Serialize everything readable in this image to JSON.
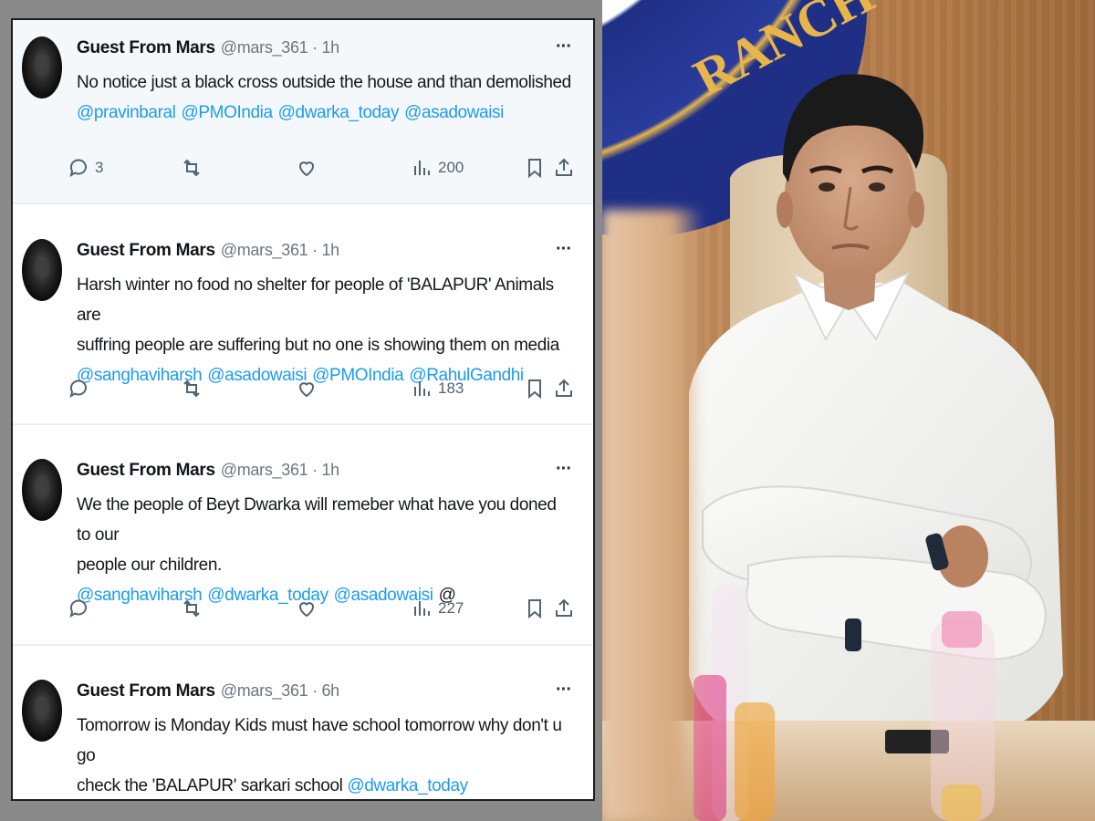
{
  "tweets": [
    {
      "author": "Guest From Mars",
      "meta": "@mars_361 · 1h",
      "text_lines": [
        "No notice just a black cross outside the house and than demolished"
      ],
      "mentions": [
        "@pravinbaral",
        "@PMOIndia",
        "@dwarka_today",
        "@asadowaisi"
      ],
      "mention_tail": "",
      "replies": "3",
      "views": "200",
      "more": "···"
    },
    {
      "author": "Guest From Mars",
      "meta": "@mars_361 · 1h",
      "text_lines": [
        "Harsh winter no food no shelter for people of 'BALAPUR' Animals are",
        "suffring people are suffering but no one is showing them on media"
      ],
      "mentions": [
        "@sanghaviharsh",
        "@asadowaisi",
        "@PMOIndia",
        "@RahulGandhi"
      ],
      "mention_tail": "",
      "replies": "",
      "views": "183",
      "more": "···"
    },
    {
      "author": "Guest From Mars",
      "meta": "@mars_361 · 1h",
      "text_lines": [
        "We the people of Beyt Dwarka will remeber what have you doned to our",
        "people our children."
      ],
      "mentions": [
        "@sanghaviharsh",
        "@dwarka_today",
        "@asadowaisi"
      ],
      "mention_tail": "@",
      "replies": "",
      "views": "227",
      "more": "···"
    },
    {
      "author": "Guest From Mars",
      "meta": "@mars_361 · 6h",
      "text_lines": [
        "Tomorrow is Monday Kids must have school tomorrow why don't u go",
        "check the 'BALAPUR' sarkari school"
      ],
      "inline_mention": "@dwarka_today",
      "more": "···"
    }
  ],
  "photo": {
    "seal_text": "RANCH",
    "colors": {
      "wall": "#b98050",
      "shirt": "#f4f4f2",
      "seal": "#1f2f86"
    }
  }
}
